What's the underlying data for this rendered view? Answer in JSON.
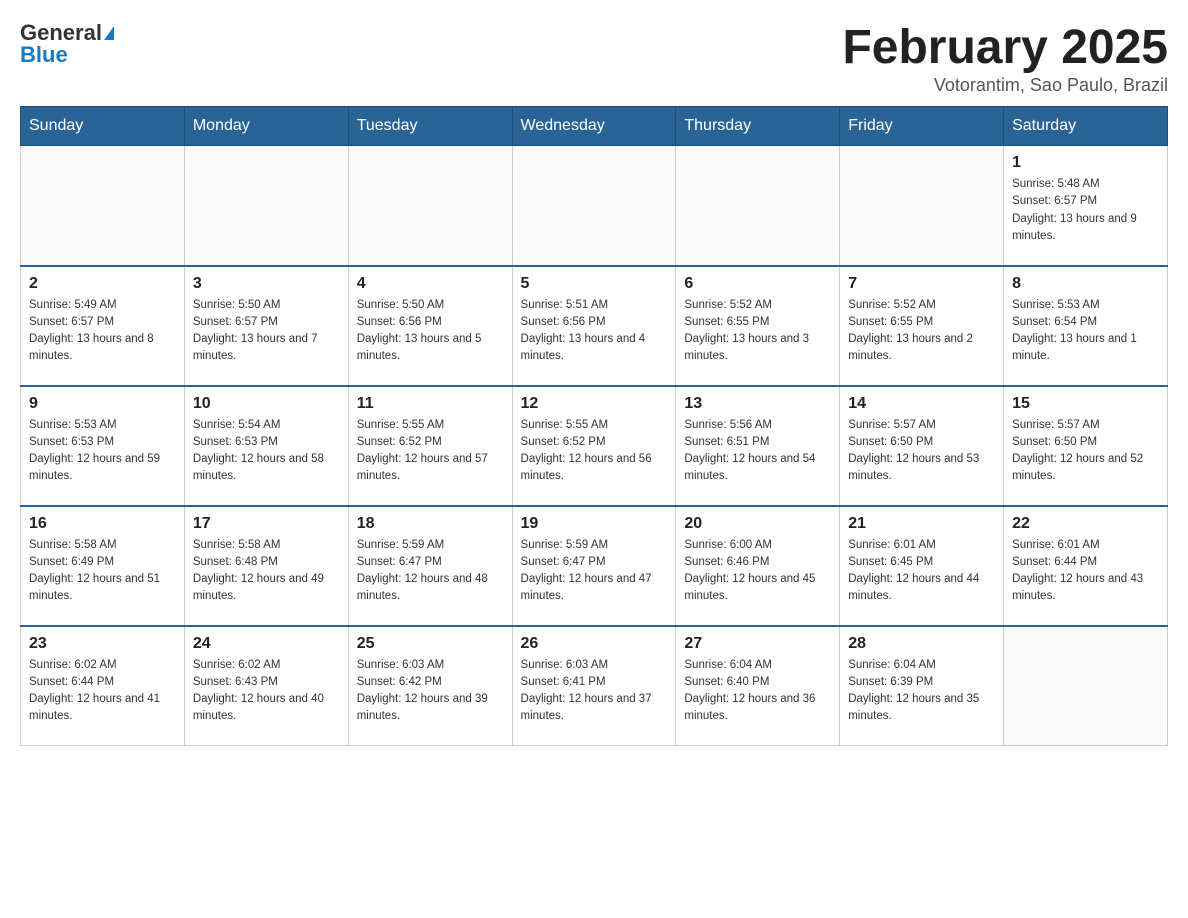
{
  "header": {
    "logo_general": "General",
    "logo_blue": "Blue",
    "month_title": "February 2025",
    "location": "Votorantim, Sao Paulo, Brazil"
  },
  "days_of_week": [
    "Sunday",
    "Monday",
    "Tuesday",
    "Wednesday",
    "Thursday",
    "Friday",
    "Saturday"
  ],
  "weeks": [
    [
      {
        "day": "",
        "info": ""
      },
      {
        "day": "",
        "info": ""
      },
      {
        "day": "",
        "info": ""
      },
      {
        "day": "",
        "info": ""
      },
      {
        "day": "",
        "info": ""
      },
      {
        "day": "",
        "info": ""
      },
      {
        "day": "1",
        "info": "Sunrise: 5:48 AM\nSunset: 6:57 PM\nDaylight: 13 hours and 9 minutes."
      }
    ],
    [
      {
        "day": "2",
        "info": "Sunrise: 5:49 AM\nSunset: 6:57 PM\nDaylight: 13 hours and 8 minutes."
      },
      {
        "day": "3",
        "info": "Sunrise: 5:50 AM\nSunset: 6:57 PM\nDaylight: 13 hours and 7 minutes."
      },
      {
        "day": "4",
        "info": "Sunrise: 5:50 AM\nSunset: 6:56 PM\nDaylight: 13 hours and 5 minutes."
      },
      {
        "day": "5",
        "info": "Sunrise: 5:51 AM\nSunset: 6:56 PM\nDaylight: 13 hours and 4 minutes."
      },
      {
        "day": "6",
        "info": "Sunrise: 5:52 AM\nSunset: 6:55 PM\nDaylight: 13 hours and 3 minutes."
      },
      {
        "day": "7",
        "info": "Sunrise: 5:52 AM\nSunset: 6:55 PM\nDaylight: 13 hours and 2 minutes."
      },
      {
        "day": "8",
        "info": "Sunrise: 5:53 AM\nSunset: 6:54 PM\nDaylight: 13 hours and 1 minute."
      }
    ],
    [
      {
        "day": "9",
        "info": "Sunrise: 5:53 AM\nSunset: 6:53 PM\nDaylight: 12 hours and 59 minutes."
      },
      {
        "day": "10",
        "info": "Sunrise: 5:54 AM\nSunset: 6:53 PM\nDaylight: 12 hours and 58 minutes."
      },
      {
        "day": "11",
        "info": "Sunrise: 5:55 AM\nSunset: 6:52 PM\nDaylight: 12 hours and 57 minutes."
      },
      {
        "day": "12",
        "info": "Sunrise: 5:55 AM\nSunset: 6:52 PM\nDaylight: 12 hours and 56 minutes."
      },
      {
        "day": "13",
        "info": "Sunrise: 5:56 AM\nSunset: 6:51 PM\nDaylight: 12 hours and 54 minutes."
      },
      {
        "day": "14",
        "info": "Sunrise: 5:57 AM\nSunset: 6:50 PM\nDaylight: 12 hours and 53 minutes."
      },
      {
        "day": "15",
        "info": "Sunrise: 5:57 AM\nSunset: 6:50 PM\nDaylight: 12 hours and 52 minutes."
      }
    ],
    [
      {
        "day": "16",
        "info": "Sunrise: 5:58 AM\nSunset: 6:49 PM\nDaylight: 12 hours and 51 minutes."
      },
      {
        "day": "17",
        "info": "Sunrise: 5:58 AM\nSunset: 6:48 PM\nDaylight: 12 hours and 49 minutes."
      },
      {
        "day": "18",
        "info": "Sunrise: 5:59 AM\nSunset: 6:47 PM\nDaylight: 12 hours and 48 minutes."
      },
      {
        "day": "19",
        "info": "Sunrise: 5:59 AM\nSunset: 6:47 PM\nDaylight: 12 hours and 47 minutes."
      },
      {
        "day": "20",
        "info": "Sunrise: 6:00 AM\nSunset: 6:46 PM\nDaylight: 12 hours and 45 minutes."
      },
      {
        "day": "21",
        "info": "Sunrise: 6:01 AM\nSunset: 6:45 PM\nDaylight: 12 hours and 44 minutes."
      },
      {
        "day": "22",
        "info": "Sunrise: 6:01 AM\nSunset: 6:44 PM\nDaylight: 12 hours and 43 minutes."
      }
    ],
    [
      {
        "day": "23",
        "info": "Sunrise: 6:02 AM\nSunset: 6:44 PM\nDaylight: 12 hours and 41 minutes."
      },
      {
        "day": "24",
        "info": "Sunrise: 6:02 AM\nSunset: 6:43 PM\nDaylight: 12 hours and 40 minutes."
      },
      {
        "day": "25",
        "info": "Sunrise: 6:03 AM\nSunset: 6:42 PM\nDaylight: 12 hours and 39 minutes."
      },
      {
        "day": "26",
        "info": "Sunrise: 6:03 AM\nSunset: 6:41 PM\nDaylight: 12 hours and 37 minutes."
      },
      {
        "day": "27",
        "info": "Sunrise: 6:04 AM\nSunset: 6:40 PM\nDaylight: 12 hours and 36 minutes."
      },
      {
        "day": "28",
        "info": "Sunrise: 6:04 AM\nSunset: 6:39 PM\nDaylight: 12 hours and 35 minutes."
      },
      {
        "day": "",
        "info": ""
      }
    ]
  ]
}
